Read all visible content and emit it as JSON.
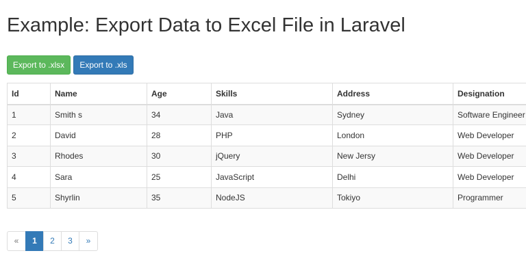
{
  "header": {
    "title": "Example: Export Data to Excel File in Laravel"
  },
  "toolbar": {
    "export_xlsx_label": "Export to .xlsx",
    "export_xls_label": "Export to .xls"
  },
  "table": {
    "columns": [
      "Id",
      "Name",
      "Age",
      "Skills",
      "Address",
      "Designation"
    ],
    "rows": [
      [
        "1",
        "Smith s",
        "34",
        "Java",
        "Sydney",
        "Software Engineer"
      ],
      [
        "2",
        "David",
        "28",
        "PHP",
        "London",
        "Web Developer"
      ],
      [
        "3",
        "Rhodes",
        "30",
        "jQuery",
        "New Jersy",
        "Web Developer"
      ],
      [
        "4",
        "Sara",
        "25",
        "JavaScript",
        "Delhi",
        "Web Developer"
      ],
      [
        "5",
        "Shyrlin",
        "35",
        "NodeJS",
        "Tokiyo",
        "Programmer"
      ]
    ]
  },
  "pagination": {
    "prev": "«",
    "pages": [
      "1",
      "2",
      "3"
    ],
    "active_page": "1",
    "next": "»"
  },
  "colors": {
    "success": "#5cb85c",
    "primary": "#337ab7",
    "border": "#dddddd",
    "stripe": "#f9f9f9"
  }
}
